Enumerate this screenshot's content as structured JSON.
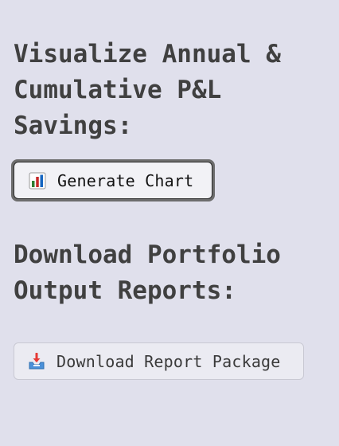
{
  "chart_section": {
    "heading": "Visualize Annual & Cumulative P&L Savings:",
    "button_label": "Generate Chart",
    "button_icon": "bar-chart-icon"
  },
  "download_section": {
    "heading": "Download Portfolio Output Reports:",
    "button_label": "Download Report Package",
    "button_icon": "inbox-tray-icon"
  },
  "colors": {
    "background": "#e0e0ec",
    "heading_text": "#404040",
    "primary_button_border": "#6d6d6d",
    "primary_button_fill": "#f2f2f6",
    "secondary_button_fill": "#ebebf2"
  }
}
